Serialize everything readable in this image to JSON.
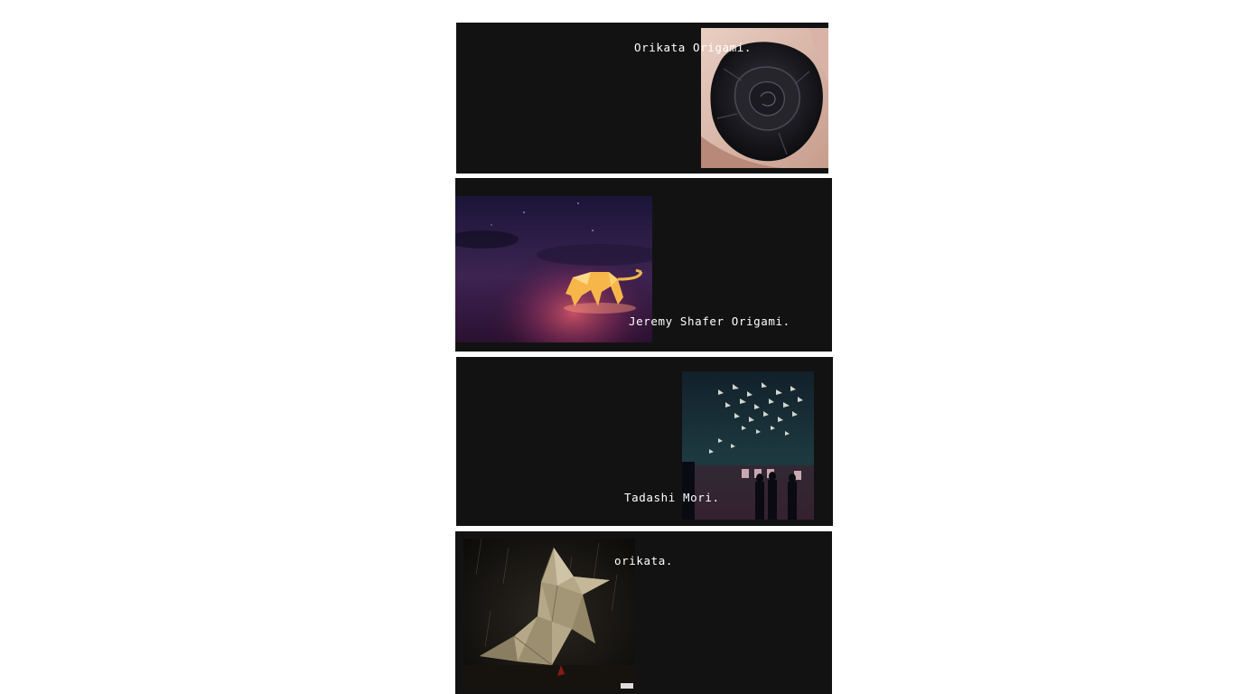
{
  "gallery": {
    "items": [
      {
        "caption": "Orikata Origami.",
        "image": "black-origami-rose-photo"
      },
      {
        "caption": "Jeremy Shafer Origami.",
        "image": "glowing-origami-tiger-photo"
      },
      {
        "caption": "Tadashi Mori.",
        "image": "origami-crane-installation-photo"
      },
      {
        "caption": "orikata.",
        "image": "origami-bird-in-rain-photo"
      }
    ]
  },
  "colors": {
    "page_background": "#ffffff",
    "card_background": "#121212",
    "caption_text": "#ffffff"
  }
}
